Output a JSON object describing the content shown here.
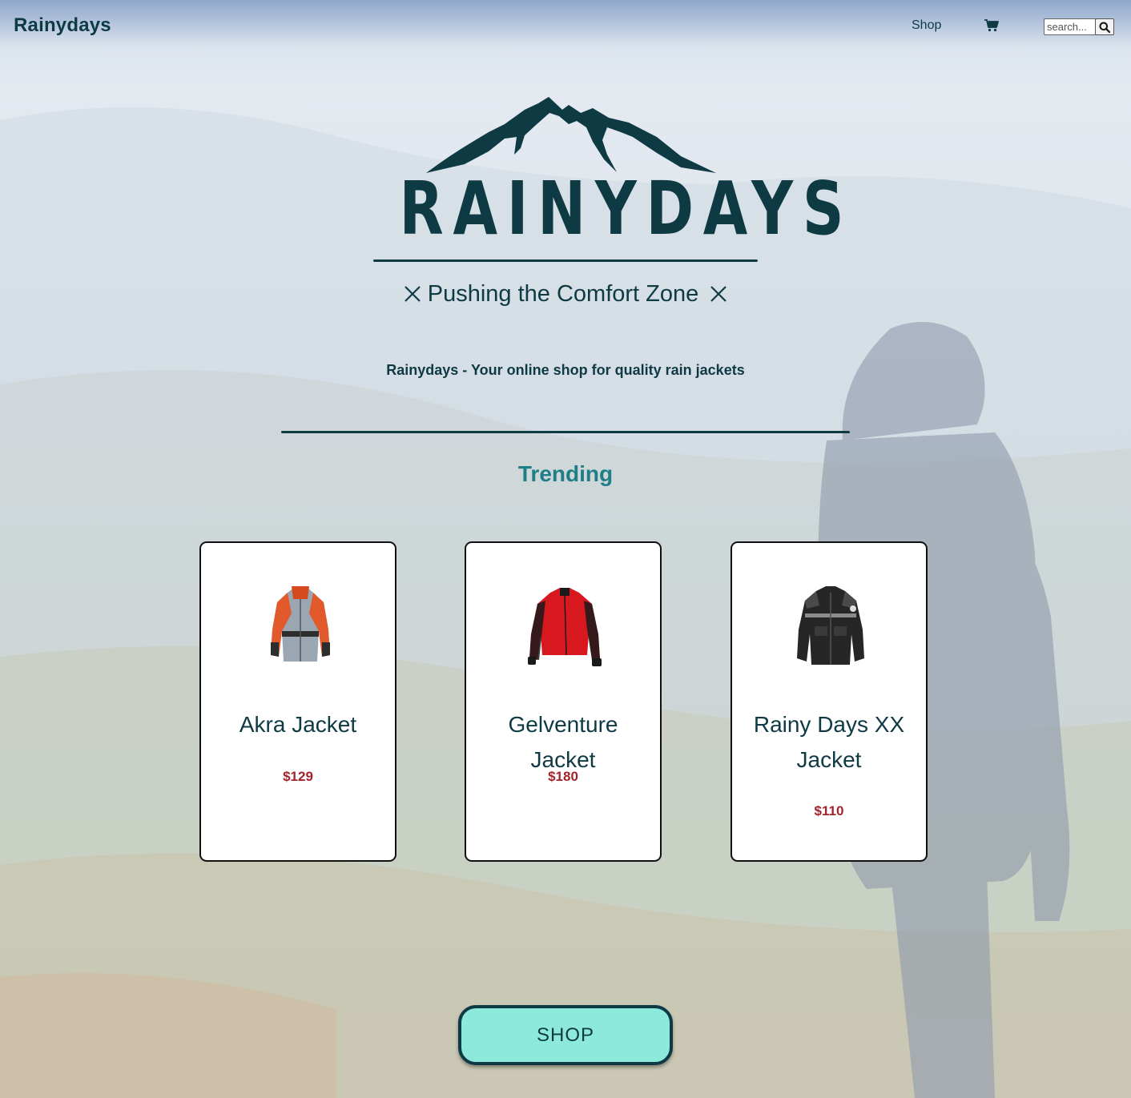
{
  "nav": {
    "brand": "Rainydays",
    "shop_label": "Shop",
    "cart_icon": "shopping-cart-icon",
    "search": {
      "placeholder": "search...",
      "button_icon": "magnifier-icon"
    }
  },
  "hero": {
    "logo_word": "RAINYDAYS",
    "logo_tagline": "Pushing the Comfort Zone",
    "intro": "Rainydays - Your online shop for quality rain jackets"
  },
  "trending": {
    "heading": "Trending",
    "products": [
      {
        "name": "Akra Jacket",
        "price": "$129",
        "image_icon": "orange-grey-jacket"
      },
      {
        "name": "Gelventure Jacket",
        "price": "$180",
        "image_icon": "red-black-jacket"
      },
      {
        "name": "Rainy Days XX Jacket",
        "price": "$110",
        "image_icon": "black-grey-jacket"
      }
    ]
  },
  "cta": {
    "shop_button": "SHOP"
  },
  "colors": {
    "primary": "#0e3a44",
    "accent": "#1f7f88",
    "price": "#a3232a",
    "button_fill": "#8de9dc"
  }
}
